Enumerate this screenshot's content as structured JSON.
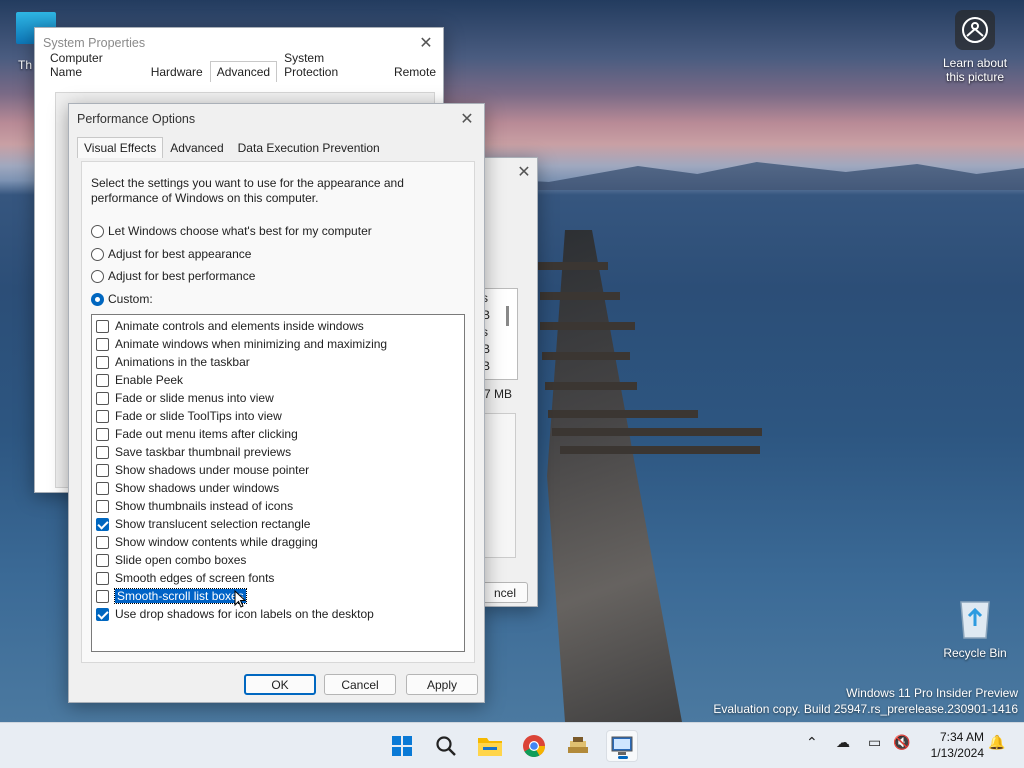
{
  "desktop": {
    "this_pc_label": "Th",
    "learn_label": "Learn about this picture",
    "recycle_label": "Recycle Bin",
    "watermark": {
      "line1": "Windows 11 Pro Insider Preview",
      "line2": "Evaluation copy. Build 25947.rs_prerelease.230901-1416"
    }
  },
  "system_properties": {
    "title": "System Properties",
    "tabs": [
      "Computer Name",
      "Hardware",
      "Advanced",
      "System Protection",
      "Remote"
    ],
    "active_tab": "Advanced"
  },
  "virtual_memory_fragment": {
    "texts": [
      "s",
      "B",
      "s",
      "B",
      "B",
      "7 MB",
      "ncel"
    ]
  },
  "performance_options": {
    "title": "Performance Options",
    "tabs": [
      "Visual Effects",
      "Advanced",
      "Data Execution Prevention"
    ],
    "active_tab": "Visual Effects",
    "description": "Select the settings you want to use for the appearance and performance of Windows on this computer.",
    "radios": [
      {
        "label": "Let Windows choose what's best for my computer",
        "selected": false
      },
      {
        "label": "Adjust for best appearance",
        "selected": false
      },
      {
        "label": "Adjust for best performance",
        "selected": false
      },
      {
        "label": "Custom:",
        "selected": true
      }
    ],
    "options": [
      {
        "label": "Animate controls and elements inside windows",
        "checked": false
      },
      {
        "label": "Animate windows when minimizing and maximizing",
        "checked": false
      },
      {
        "label": "Animations in the taskbar",
        "checked": false
      },
      {
        "label": "Enable Peek",
        "checked": false
      },
      {
        "label": "Fade or slide menus into view",
        "checked": false
      },
      {
        "label": "Fade or slide ToolTips into view",
        "checked": false
      },
      {
        "label": "Fade out menu items after clicking",
        "checked": false
      },
      {
        "label": "Save taskbar thumbnail previews",
        "checked": false
      },
      {
        "label": "Show shadows under mouse pointer",
        "checked": false
      },
      {
        "label": "Show shadows under windows",
        "checked": false
      },
      {
        "label": "Show thumbnails instead of icons",
        "checked": false
      },
      {
        "label": "Show translucent selection rectangle",
        "checked": true
      },
      {
        "label": "Show window contents while dragging",
        "checked": false
      },
      {
        "label": "Slide open combo boxes",
        "checked": false
      },
      {
        "label": "Smooth edges of screen fonts",
        "checked": false
      },
      {
        "label": "Smooth-scroll list boxes",
        "checked": false,
        "focused": true
      },
      {
        "label": "Use drop shadows for icon labels on the desktop",
        "checked": true
      }
    ],
    "buttons": {
      "ok": "OK",
      "cancel": "Cancel",
      "apply": "Apply"
    }
  },
  "taskbar": {
    "apps": [
      "start-icon",
      "search-icon",
      "file-explorer-icon",
      "chrome-icon",
      "app-stack-icon",
      "system-properties-icon"
    ],
    "time": "7:34 AM",
    "date": "1/13/2024"
  }
}
